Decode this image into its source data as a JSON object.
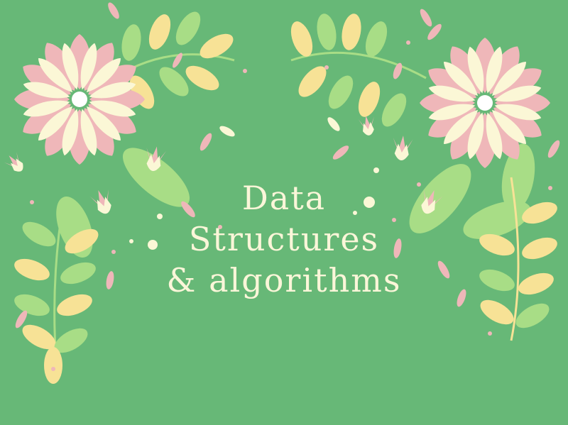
{
  "title": {
    "line1": "Data",
    "line2": "Structures",
    "line3": "& algorithms"
  },
  "colors": {
    "background": "#67b877",
    "petal_pink": "#efb7b9",
    "petal_cream": "#fbf7d6",
    "leaf_green": "#a8dd86",
    "leaf_yellow": "#f7e296",
    "text": "#fbf6d9"
  },
  "icons": [
    "flower-icon",
    "leaf-icon",
    "tulip-icon",
    "dot-icon"
  ]
}
